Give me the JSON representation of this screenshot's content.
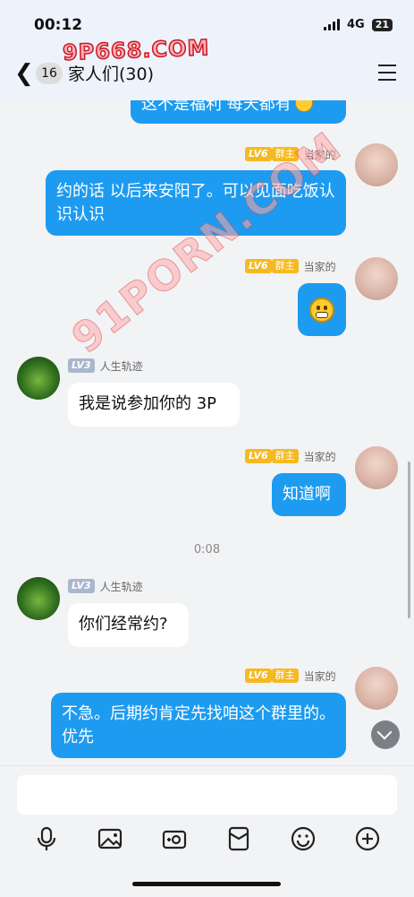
{
  "status_bar": {
    "time": "00:12",
    "network": "4G",
    "battery": "21"
  },
  "watermark": {
    "top": "9P668.COM",
    "diagonal": "91PORN.COM"
  },
  "header": {
    "unread_count": "16",
    "title": "家人们(30)"
  },
  "messages": [
    {
      "side": "right",
      "text": "这不是福利 每天都有"
    },
    {
      "side": "right",
      "level": "LV6",
      "role": "群主",
      "sender": "当家的",
      "text": "约的话 以后来安阳了。可以见面吃饭认识认识"
    },
    {
      "side": "right",
      "level": "LV6",
      "role": "群主",
      "sender": "当家的",
      "emoji": "grin-emoji"
    },
    {
      "side": "left",
      "level": "LV3",
      "sender": "人生轨迹",
      "text": "我是说参加你的 3P"
    },
    {
      "side": "right",
      "level": "LV6",
      "role": "群主",
      "sender": "当家的",
      "text": "知道啊"
    },
    {
      "side": "left",
      "level": "LV3",
      "sender": "人生轨迹",
      "text": "你们经常约?"
    },
    {
      "side": "right",
      "level": "LV6",
      "role": "群主",
      "sender": "当家的",
      "text": "不急。后期约肯定先找咱这个群里的。优先"
    }
  ],
  "time_separator": "0:08",
  "input": {
    "placeholder": ""
  },
  "toolbar_icons": [
    "mic-icon",
    "image-icon",
    "camera-icon",
    "redpacket-icon",
    "emoji-icon",
    "plus-icon"
  ]
}
